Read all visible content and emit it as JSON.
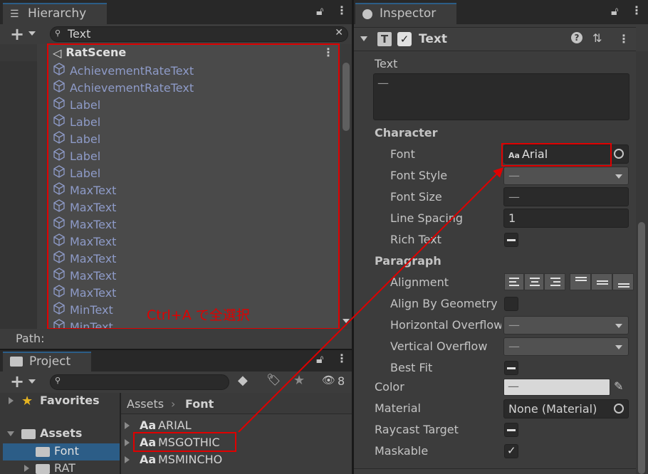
{
  "hierarchy": {
    "tab_label": "Hierarchy",
    "search_value": "Text",
    "scene_name": "RatScene",
    "items": [
      "AchievementRateText",
      "AchievementRateText",
      "Label",
      "Label",
      "Label",
      "Label",
      "Label",
      "MaxText",
      "MaxText",
      "MaxText",
      "MaxText",
      "MaxText",
      "MaxText",
      "MaxText",
      "MinText",
      "MinText"
    ],
    "annotation": "Ctrl+A で全選択",
    "path_label": "Path:"
  },
  "project": {
    "tab_label": "Project",
    "hidden_count": "8",
    "tree": {
      "favorites": "Favorites",
      "assets": "Assets",
      "font": "Font",
      "rat": "RAT"
    },
    "breadcrumb": {
      "root": "Assets",
      "current": "Font"
    },
    "files": [
      {
        "icon": "Aa",
        "name": "ARIAL"
      },
      {
        "icon": "Aa",
        "name": "MSGOTHIC"
      },
      {
        "icon": "Aa",
        "name": "MSMINCHO"
      }
    ]
  },
  "inspector": {
    "tab_label": "Inspector",
    "component_name": "Text",
    "text_label": "Text",
    "text_value": "—",
    "character_header": "Character",
    "font_label": "Font",
    "font_icon": "Aa",
    "font_value": "Arial",
    "font_style_label": "Font Style",
    "font_style_value": "—",
    "font_size_label": "Font Size",
    "font_size_value": "—",
    "line_spacing_label": "Line Spacing",
    "line_spacing_value": "1",
    "rich_text_label": "Rich Text",
    "paragraph_header": "Paragraph",
    "alignment_label": "Alignment",
    "align_by_geometry_label": "Align By Geometry",
    "horizontal_overflow_label": "Horizontal Overflow",
    "horizontal_overflow_value": "—",
    "vertical_overflow_label": "Vertical Overflow",
    "vertical_overflow_value": "—",
    "best_fit_label": "Best Fit",
    "color_label": "Color",
    "color_value": "—",
    "material_label": "Material",
    "material_value": "None (Material)",
    "raycast_target_label": "Raycast Target",
    "maskable_label": "Maskable"
  },
  "colors": {
    "accent_red": "#e00000",
    "tab_highlight": "#2c5d87",
    "selected_row": "#2c5d87",
    "hierarchy_item_text": "#8e9bc8"
  }
}
